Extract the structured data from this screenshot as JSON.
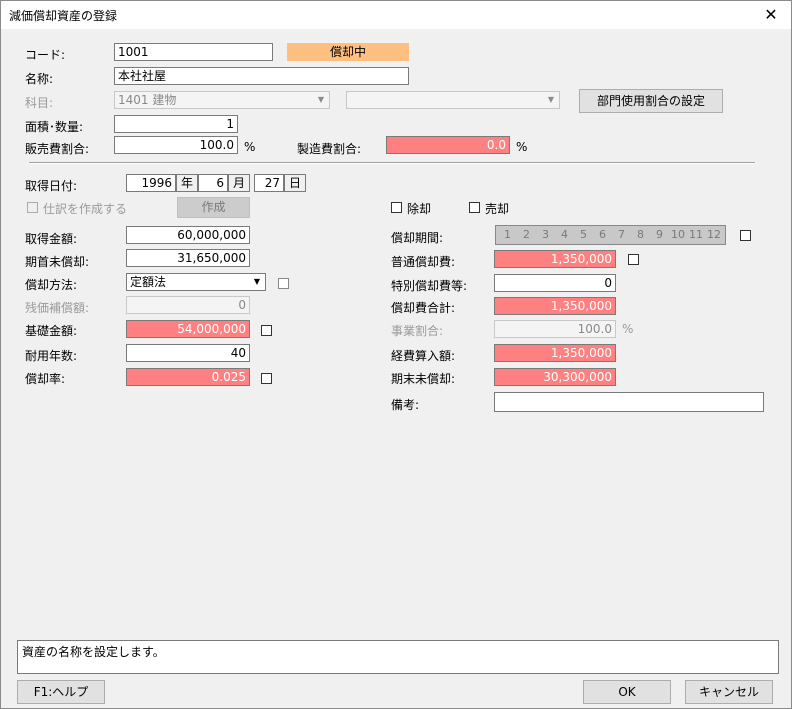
{
  "window": {
    "title": "減価償却資産の登録",
    "close": "✕"
  },
  "code": {
    "label": "コード:",
    "value": "1001",
    "status": "償却中"
  },
  "name": {
    "label": "名称:",
    "value": "本社社屋"
  },
  "subject": {
    "label": "科目:",
    "value": "1401 建物",
    "value2": ""
  },
  "dept_button": "部門使用割合の設定",
  "area": {
    "label": "面積･数量:",
    "value": "1"
  },
  "sales_ratio": {
    "label": "販売費割合:",
    "value": "100.0",
    "unit": "%"
  },
  "mfg_ratio": {
    "label": "製造費割合:",
    "value": "0.0",
    "unit": "%"
  },
  "acq_date": {
    "label": "取得日付:",
    "year": "1996",
    "year_unit": "年",
    "month": "6",
    "month_unit": "月",
    "day": "27",
    "day_unit": "日"
  },
  "journal": {
    "label": "仕訳を作成する",
    "button": "作成"
  },
  "dispose": {
    "label": "除却"
  },
  "sell": {
    "label": "売却"
  },
  "left": {
    "acq_amount": {
      "label": "取得金額:",
      "value": "60,000,000"
    },
    "begin_undep": {
      "label": "期首未償却:",
      "value": "31,650,000"
    },
    "method": {
      "label": "償却方法:",
      "value": "定額法"
    },
    "residual": {
      "label": "残価補償額:",
      "value": "0"
    },
    "base_amount": {
      "label": "基礎金額:",
      "value": "54,000,000"
    },
    "life": {
      "label": "耐用年数:",
      "value": "40"
    },
    "rate": {
      "label": "償却率:",
      "value": "0.025"
    }
  },
  "right": {
    "period": {
      "label": "償却期間:",
      "months": [
        "1",
        "2",
        "3",
        "4",
        "5",
        "6",
        "7",
        "8",
        "9",
        "10",
        "11",
        "12"
      ]
    },
    "normal_dep": {
      "label": "普通償却費:",
      "value": "1,350,000"
    },
    "special_dep": {
      "label": "特別償却費等:",
      "value": "0"
    },
    "dep_total": {
      "label": "償却費合計:",
      "value": "1,350,000"
    },
    "business_ratio": {
      "label": "事業割合:",
      "value": "100.0",
      "unit": "%"
    },
    "expense": {
      "label": "経費算入額:",
      "value": "1,350,000"
    },
    "end_undep": {
      "label": "期末未償却:",
      "value": "30,300,000"
    },
    "memo": {
      "label": "備考:",
      "value": ""
    }
  },
  "message": "資産の名称を設定します。",
  "buttons": {
    "help": "F1:ヘルプ",
    "ok": "OK",
    "cancel": "キャンセル"
  },
  "colors": {
    "pink": "#ff8080",
    "status": "#ffbf80"
  }
}
